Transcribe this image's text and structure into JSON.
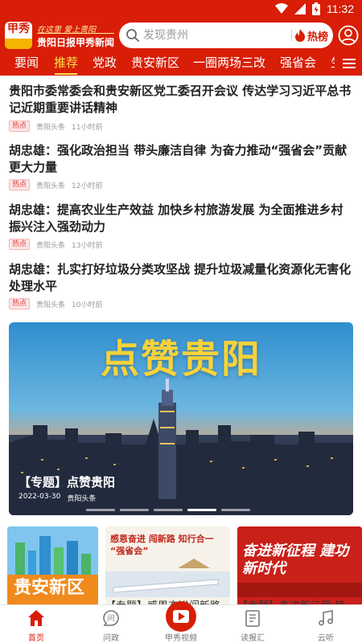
{
  "status_bar": {
    "time": "11:32"
  },
  "header": {
    "logo_char": "甲秀",
    "logo_slogan": "在这里 爱上贵阳",
    "logo_name": "贵阳日报甲秀新闻",
    "search_placeholder": "发现贵州",
    "hot_label": "热榜"
  },
  "tabs": [
    "要闻",
    "推荐",
    "党政",
    "贵安新区",
    "一圈两场三改",
    "强省会",
    "生"
  ],
  "active_tab": "推荐",
  "news": [
    {
      "title": "贵阳市委常委会和贵安新区党工委召开会议 传达学习习近平总书记近期重要讲话精神",
      "badge": "热点",
      "source": "贵阳头条",
      "time": "11小时前"
    },
    {
      "title": "胡忠雄：强化政治担当 带头廉洁自律 为奋力推动“强省会”贡献更大力量",
      "badge": "热点",
      "source": "贵阳头条",
      "time": "12小时前"
    },
    {
      "title": "胡忠雄：提高农业生产效益 加快乡村旅游发展 为全面推进乡村振兴注入强劲动力",
      "badge": "热点",
      "source": "贵阳头条",
      "time": "13小时前"
    },
    {
      "title": "胡忠雄：扎实打好垃圾分类攻坚战 提升垃圾减量化资源化无害化处理水平",
      "badge": "热点",
      "source": "贵阳头条",
      "time": "10小时前"
    }
  ],
  "banner": {
    "art_text": "点赞贵阳",
    "caption": "【专题】点赞贵阳",
    "date": "2022-03-30",
    "source": "贵阳头条"
  },
  "cards": [
    {
      "art_text": "贵安新区",
      "caption": ""
    },
    {
      "art_text": "感恩奋进 闯新路 知行合一 “强省会”",
      "caption": "【专题】感恩奋进闯新路"
    },
    {
      "art_text": "奋进新征程 建功新时代",
      "caption": "【专题】奋进新征程 建"
    }
  ],
  "bottom_nav": [
    {
      "label": "首页",
      "icon": "home-icon"
    },
    {
      "label": "问政",
      "icon": "chat-icon"
    },
    {
      "label": "甲秀视频",
      "icon": "video-play-icon"
    },
    {
      "label": "读报汇",
      "icon": "newspaper-icon"
    },
    {
      "label": "云听",
      "icon": "music-icon"
    }
  ],
  "colors": {
    "brand_red": "#d81e06",
    "active_tab": "#ffe14a",
    "banner_text": "#f7d23a"
  }
}
